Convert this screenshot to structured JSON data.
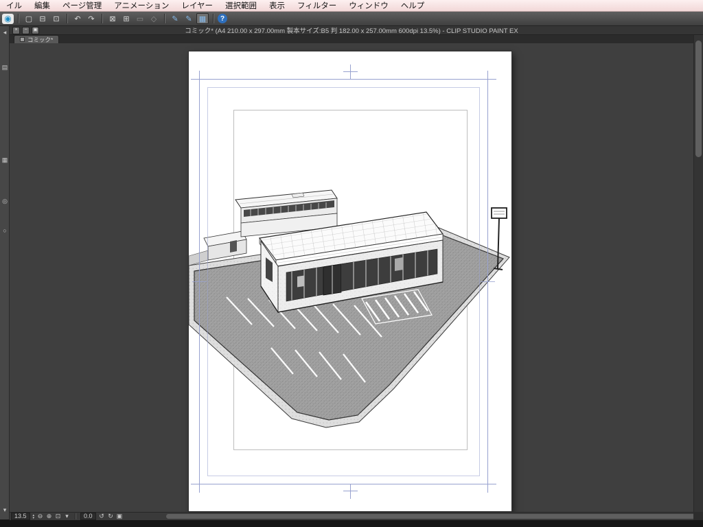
{
  "menu": {
    "items": [
      "イル",
      "編集",
      "ページ管理",
      "アニメーション",
      "レイヤー",
      "選択範囲",
      "表示",
      "フィルター",
      "ウィンドウ",
      "ヘルプ"
    ]
  },
  "toolbar": {
    "icons": [
      {
        "name": "clip-studio-logo",
        "glyph": "◉"
      },
      {
        "name": "new-document-icon",
        "glyph": "▢"
      },
      {
        "name": "open-file-icon",
        "glyph": "⊟"
      },
      {
        "name": "save-icon",
        "glyph": "⊡"
      },
      {
        "name": "undo-icon",
        "glyph": "↶"
      },
      {
        "name": "redo-icon",
        "glyph": "↷"
      },
      {
        "name": "deselect-icon",
        "glyph": "⊠"
      },
      {
        "name": "invert-selection-icon",
        "glyph": "⊞"
      },
      {
        "name": "selection-launcher-icon",
        "glyph": "▭"
      },
      {
        "name": "transform-icon",
        "glyph": "◇"
      },
      {
        "name": "snap-to-ruler-icon",
        "glyph": "✎"
      },
      {
        "name": "snap-to-special-ruler-icon",
        "glyph": "✎"
      },
      {
        "name": "snap-to-grid-icon",
        "glyph": "▦"
      },
      {
        "name": "help-icon",
        "glyph": "?"
      }
    ]
  },
  "window": {
    "title": "コミック* (A4 210.00 x 297.00mm 製本サイズ:B5 判 182.00 x 257.00mm 600dpi 13.5%)  - CLIP STUDIO PAINT EX",
    "buttons": {
      "close": "×",
      "minimize": "−",
      "shade": "▣"
    }
  },
  "tabs": [
    {
      "label": "コミック*"
    }
  ],
  "left_toolbar": {
    "icons": [
      {
        "name": "collapse-panel-icon",
        "glyph": "◂"
      },
      {
        "name": "palette-dock-icon",
        "glyph": "▤"
      },
      {
        "name": "quick-access-icon",
        "glyph": "▦"
      },
      {
        "name": "subview-icon",
        "glyph": "◎"
      },
      {
        "name": "item-bank-icon",
        "glyph": "○"
      },
      {
        "name": "scroll-down-icon",
        "glyph": "▾"
      }
    ]
  },
  "status_bar": {
    "zoom_value": "13.5",
    "rotation_value": "0.0",
    "icons": [
      {
        "name": "zoom-stepper-up-icon",
        "glyph": "▴"
      },
      {
        "name": "zoom-stepper-down-icon",
        "glyph": "▾"
      },
      {
        "name": "zoom-out-icon",
        "glyph": "⊖"
      },
      {
        "name": "zoom-in-icon",
        "glyph": "⊕"
      },
      {
        "name": "fit-to-screen-icon",
        "glyph": "⊡"
      },
      {
        "name": "zoom-dropdown-icon",
        "glyph": "▾"
      },
      {
        "name": "rotate-ccw-icon",
        "glyph": "↺"
      },
      {
        "name": "rotate-cw-icon",
        "glyph": "↻"
      },
      {
        "name": "reset-view-icon",
        "glyph": "▣"
      }
    ]
  },
  "colors": {
    "menu_pink": "#f6dede",
    "canvas_gray": "#3f3f3f",
    "guide_blue": "#97a1cf",
    "help_blue": "#2e6fbd"
  }
}
